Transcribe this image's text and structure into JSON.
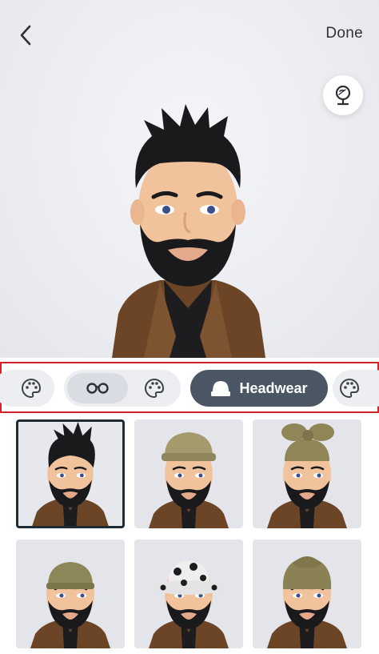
{
  "header": {
    "back_icon": "chevron-left-icon",
    "done_label": "Done",
    "mirror_icon": "mirror-icon"
  },
  "categories": [
    {
      "icon": "palette-icon",
      "label": "",
      "state": "inactive"
    },
    {
      "icon": "glasses-icon",
      "label": "",
      "state": "inactive"
    },
    {
      "icon": "palette-icon",
      "label": "",
      "state": "inactive"
    },
    {
      "icon": "beanie-icon",
      "label": "Headwear",
      "state": "active"
    },
    {
      "icon": "palette-icon",
      "label": "",
      "state": "inactive"
    }
  ],
  "colors": {
    "active_pill": "#4a5664",
    "inactive_pill": "#eceef2",
    "highlight_border": "#d4232b",
    "jacket": "#6b4526",
    "hair": "#1a1a1d",
    "skin": "#f1c39d"
  },
  "headwear_options": [
    {
      "name": "none",
      "hat_color": "",
      "selected": true
    },
    {
      "name": "olive-cap",
      "hat_color": "#a59a6b",
      "selected": false
    },
    {
      "name": "olive-head-wrap-bow",
      "hat_color": "#8f8556",
      "selected": false
    },
    {
      "name": "olive-beanie",
      "hat_color": "#8d8659",
      "selected": false
    },
    {
      "name": "floral-bucket-hat",
      "hat_color": "#eeeeee",
      "selected": false
    },
    {
      "name": "olive-turban",
      "hat_color": "#8a8255",
      "selected": false
    }
  ]
}
